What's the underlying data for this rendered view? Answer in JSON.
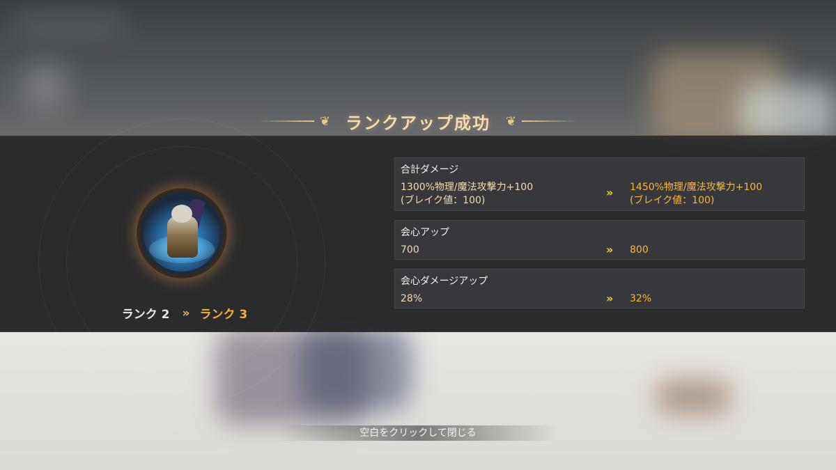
{
  "title": "ランクアップ成功",
  "rank": {
    "old": "ランク 2",
    "arrow": "»",
    "new": "ランク 3"
  },
  "stats": [
    {
      "name": "合計ダメージ",
      "old": "1300%物理/魔法攻撃力+100\n(ブレイク値：100)",
      "new": "1450%物理/魔法攻撃力+100\n(ブレイク値：100)"
    },
    {
      "name": "会心アップ",
      "old": "700",
      "new": "800"
    },
    {
      "name": "会心ダメージアップ",
      "old": "28%",
      "new": "32%"
    }
  ],
  "arrow_glyph": "»",
  "close_hint": "空白をクリックして閉じる",
  "colors": {
    "accent_gold": "#f2b23a",
    "title_gold": "#f3dcae",
    "arrow_yellow": "#e8dc2a",
    "panel_bg": "#2a2b2d"
  }
}
